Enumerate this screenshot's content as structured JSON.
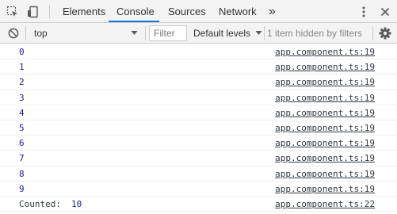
{
  "tabs": [
    {
      "label": "Elements"
    },
    {
      "label": "Console",
      "active": true
    },
    {
      "label": "Sources"
    },
    {
      "label": "Network"
    }
  ],
  "more_tabs_glyph": "»",
  "toolbar": {
    "context": "top",
    "filter_placeholder": "Filter",
    "levels_label": "Default levels",
    "hidden_note": "1 item hidden by filters"
  },
  "colors": {
    "accent": "#1a73e8",
    "value": "#1a1aa6"
  },
  "console": {
    "rows": [
      {
        "value": "0",
        "source": "app.component.ts:19"
      },
      {
        "value": "1",
        "source": "app.component.ts:19"
      },
      {
        "value": "2",
        "source": "app.component.ts:19"
      },
      {
        "value": "3",
        "source": "app.component.ts:19"
      },
      {
        "value": "4",
        "source": "app.component.ts:19"
      },
      {
        "value": "5",
        "source": "app.component.ts:19"
      },
      {
        "value": "6",
        "source": "app.component.ts:19"
      },
      {
        "value": "7",
        "source": "app.component.ts:19"
      },
      {
        "value": "8",
        "source": "app.component.ts:19"
      },
      {
        "value": "9",
        "source": "app.component.ts:19"
      }
    ],
    "count_row": {
      "label": "Counted:",
      "value": "10",
      "source": "app.component.ts:22"
    }
  }
}
